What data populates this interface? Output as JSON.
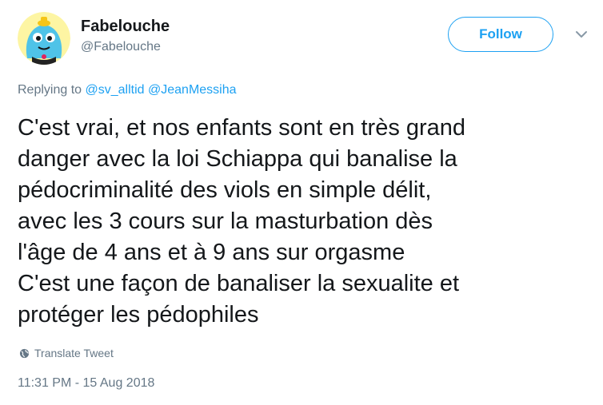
{
  "author": {
    "display_name": "Fabelouche",
    "handle": "@Fabelouche",
    "avatar_icon": "cartoon-blob-avatar"
  },
  "follow_button": {
    "label": "Follow"
  },
  "menu": {
    "icon": "chevron-down-icon"
  },
  "reply": {
    "prefix": "Replying to",
    "mentions": [
      "@sv_alltid",
      "@JeanMessiha"
    ]
  },
  "tweet": {
    "lines": [
      "C'est vrai, et nos enfants sont en très grand",
      "danger avec la loi Schiappa qui banalise la",
      "pédocriminalité des viols en simple délit,",
      "avec les 3 cours sur la masturbation dès",
      "l'âge de 4 ans et à 9 ans sur orgasme",
      "C'est une façon de banaliser la sexualite et",
      "protéger les pédophiles"
    ]
  },
  "translate": {
    "label": "Translate Tweet",
    "icon": "globe-icon"
  },
  "timestamp": "11:31 PM - 15 Aug 2018",
  "colors": {
    "text": "#14171a",
    "secondary": "#657786",
    "accent": "#1da1f2",
    "avatar_bg": "#fdf5a3",
    "avatar_blob": "#4fc3e8"
  }
}
